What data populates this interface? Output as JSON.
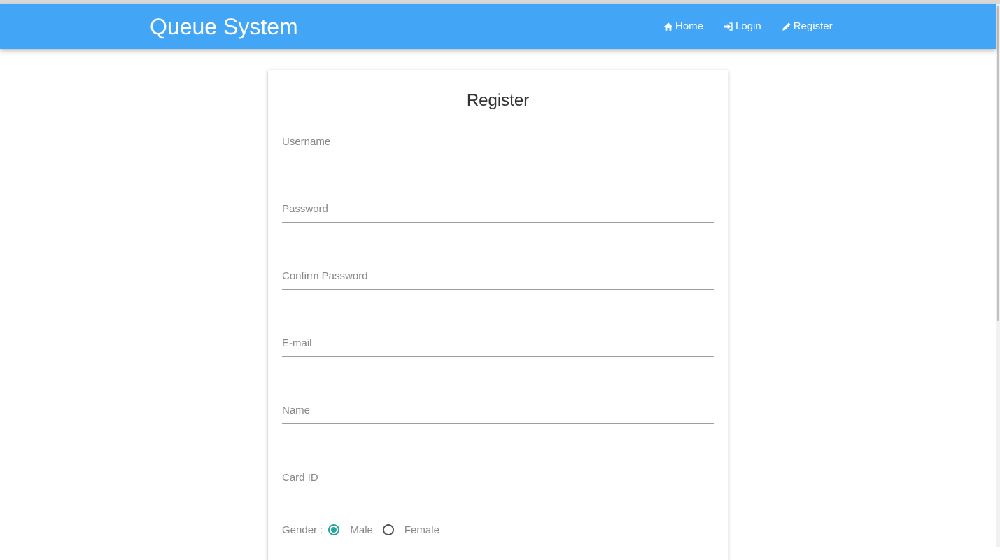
{
  "navbar": {
    "brand": "Queue System",
    "links": [
      {
        "label": "Home",
        "icon": "home-icon"
      },
      {
        "label": "Login",
        "icon": "sign-in-icon"
      },
      {
        "label": "Register",
        "icon": "pencil-icon"
      }
    ]
  },
  "form": {
    "title": "Register",
    "fields": [
      {
        "label": "Username"
      },
      {
        "label": "Password"
      },
      {
        "label": "Confirm Password"
      },
      {
        "label": "E-mail"
      },
      {
        "label": "Name"
      },
      {
        "label": "Card ID"
      }
    ],
    "gender": {
      "label": "Gender :",
      "options": [
        {
          "label": "Male",
          "checked": true
        },
        {
          "label": "Female",
          "checked": false
        }
      ]
    }
  },
  "colors": {
    "navbar": "#42a5f5",
    "radio_checked": "#26a69a"
  }
}
